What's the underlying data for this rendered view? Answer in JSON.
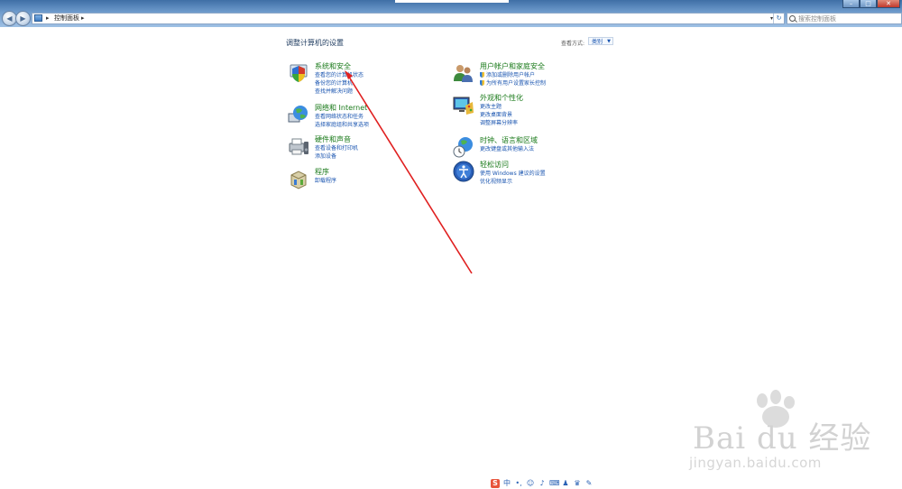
{
  "window": {
    "title_icons": {
      "minimize": "–",
      "maximize": "□",
      "close": "✕"
    }
  },
  "nav": {
    "back_glyph": "◀",
    "forward_glyph": "▶"
  },
  "address_bar": {
    "crumbs": [
      "控制面板"
    ],
    "chevron": "▸",
    "dropdown_glyph": "▾",
    "refresh_glyph": "↻"
  },
  "search": {
    "placeholder": "搜索控制面板"
  },
  "main": {
    "heading": "调整计算机的设置",
    "view_by_label": "查看方式:",
    "view_by_value": "类别",
    "categories": [
      {
        "title": "系统和安全",
        "icon": "shield-computer-icon",
        "links": [
          "查看您的计算机状态",
          "备份您的计算机",
          "查找并解决问题"
        ]
      },
      {
        "title": "网络和 Internet",
        "icon": "globe-network-icon",
        "links": [
          "查看网络状态和任务",
          "选择家庭组和共享选项"
        ]
      },
      {
        "title": "硬件和声音",
        "icon": "printer-speaker-icon",
        "links": [
          "查看设备和打印机",
          "添加设备"
        ]
      },
      {
        "title": "程序",
        "icon": "programs-box-icon",
        "links": [
          "卸载程序"
        ]
      },
      {
        "title": "用户帐户和家庭安全",
        "icon": "users-icon",
        "links": [
          "添加或删除用户帐户",
          "为所有用户设置家长控制"
        ]
      },
      {
        "title": "外观和个性化",
        "icon": "monitor-palette-icon",
        "links": [
          "更改主题",
          "更改桌面背景",
          "调整屏幕分辨率"
        ]
      },
      {
        "title": "时钟、语言和区域",
        "icon": "clock-globe-icon",
        "links": [
          "更改键盘或其他输入法"
        ]
      },
      {
        "title": "轻松访问",
        "icon": "ease-of-access-icon",
        "links": [
          "使用 Windows 建议的设置",
          "优化视频显示"
        ]
      }
    ]
  },
  "watermark": {
    "brand": "Bai du 经验",
    "url": "jingyan.baidu.com"
  },
  "tray": {
    "items": [
      "S",
      "中",
      "•,",
      "☺",
      "♪",
      "⌨",
      "♟",
      "♛",
      "✎"
    ]
  },
  "colors": {
    "link": "#1a55b0",
    "category_title": "#1a7a1a",
    "annotation_arrow": "#e02020"
  }
}
